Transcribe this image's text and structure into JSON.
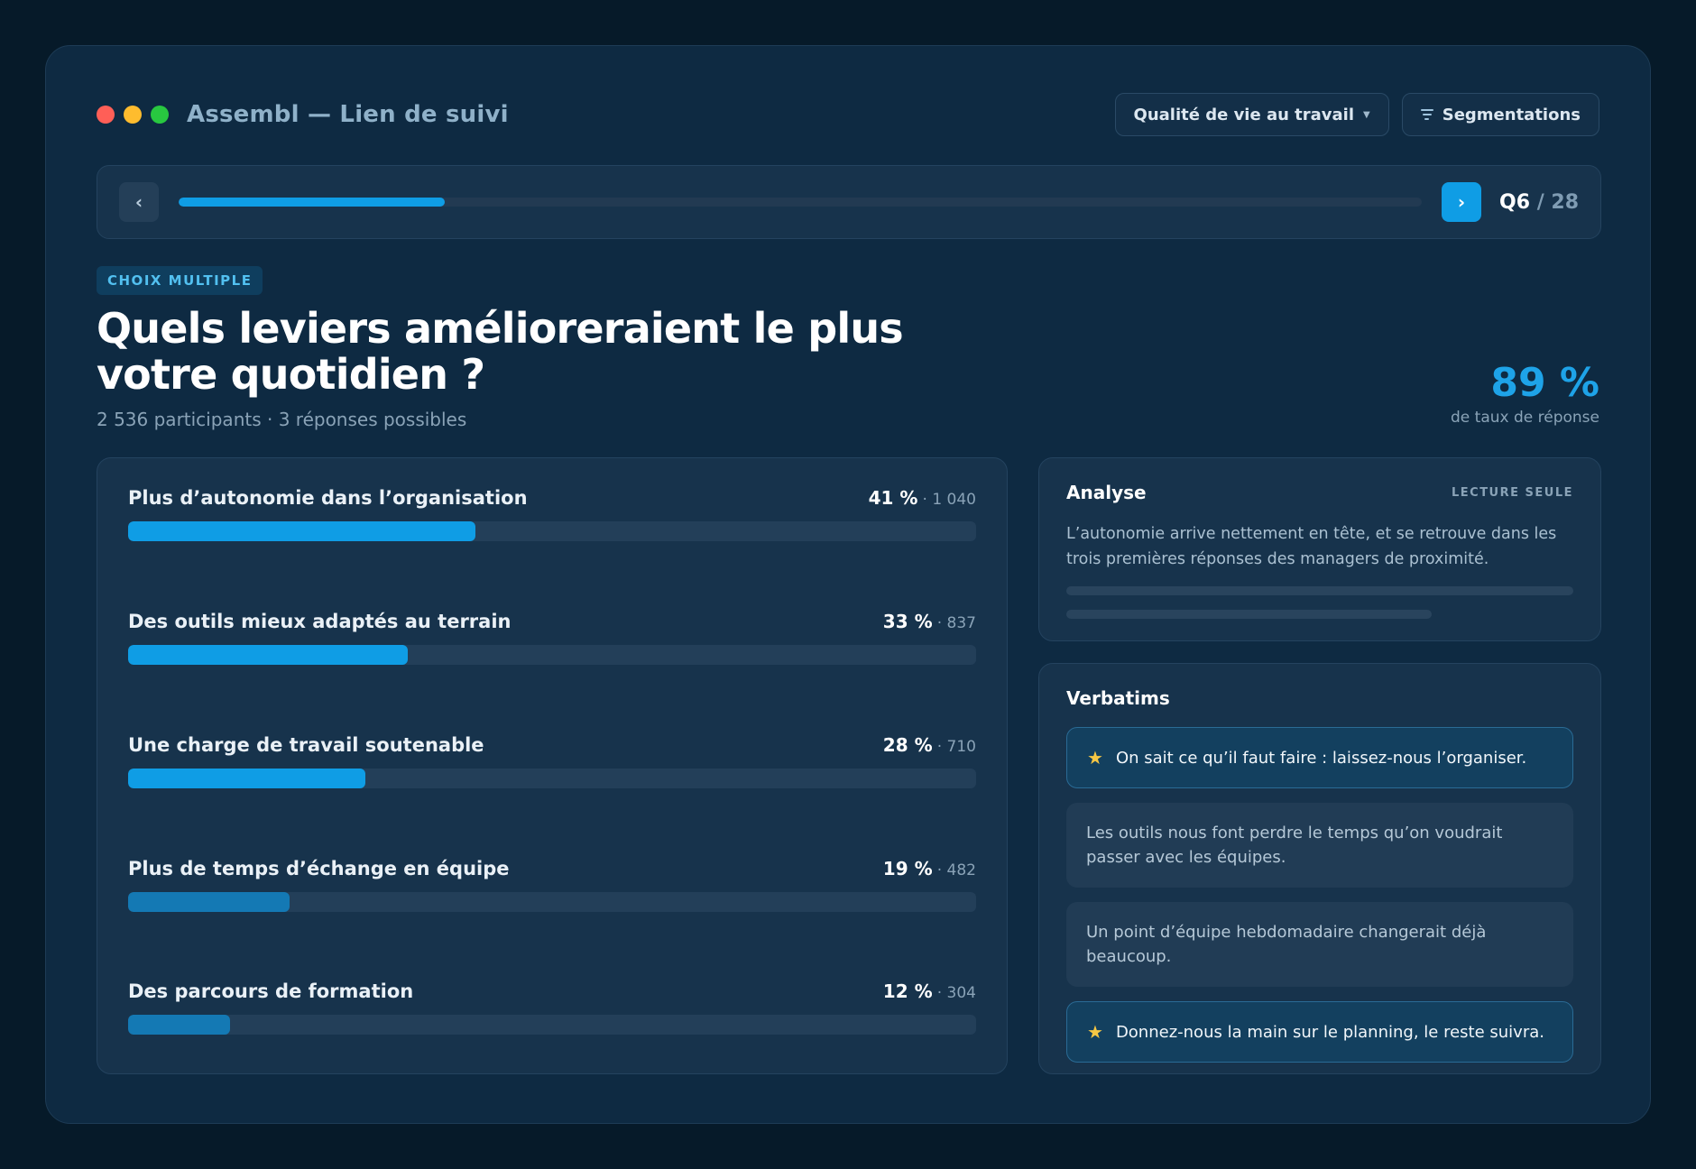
{
  "window": {
    "title": "Assembl — Lien de suivi",
    "dot_colors": [
      "#ff5f57",
      "#febc2e",
      "#28c840"
    ]
  },
  "header": {
    "survey_selector": {
      "label": "Qualité de vie au travail",
      "icon": "chevron-down-icon"
    },
    "segmentations": {
      "label": "Segmentations",
      "icon": "filter-icon"
    }
  },
  "navigation": {
    "prev_icon": "chevron-left-icon",
    "next_icon": "chevron-right-icon",
    "progress_fraction": 0.214,
    "current": "Q6",
    "total": "/ 28"
  },
  "question": {
    "type": "CHOIX MULTIPLE",
    "title": "Quels leviers amélioreraient le plus votre quotidien ?",
    "subtitle": "2 536 participants · 3 réponses possibles",
    "response_rate": {
      "value": "89 %",
      "label": "de taux de réponse"
    }
  },
  "results": {
    "options": [
      {
        "label": "Plus d’autonomie dans l’organisation",
        "pct": "41 %",
        "count": "· 1 040",
        "fraction": 0.41,
        "color": "#0f9de5"
      },
      {
        "label": "Des outils mieux adaptés au terrain",
        "pct": "33 %",
        "count": "· 837",
        "fraction": 0.33,
        "color": "#0f9de5"
      },
      {
        "label": "Une charge de travail soutenable",
        "pct": "28 %",
        "count": "· 710",
        "fraction": 0.28,
        "color": "#0f9de5"
      },
      {
        "label": "Plus de temps d’échange en équipe",
        "pct": "19 %",
        "count": "· 482",
        "fraction": 0.19,
        "color": "#1479b4"
      },
      {
        "label": "Des parcours de formation",
        "pct": "12 %",
        "count": "· 304",
        "fraction": 0.12,
        "color": "#1479b4"
      }
    ]
  },
  "analysis": {
    "title": "Analyse",
    "badge": "LECTURE SEULE",
    "text": "L’autonomie arrive nettement en tête, et se retrouve dans les trois premières réponses des managers de proximité."
  },
  "verbatims": {
    "title": "Verbatims",
    "items": [
      {
        "text": "On sait ce qu’il faut faire : laissez-nous l’organiser.",
        "highlighted": true
      },
      {
        "text": "Les outils nous font perdre le temps qu’on voudrait passer avec les équipes.",
        "highlighted": false
      },
      {
        "text": "Un point d’équipe hebdomadaire changerait déjà beaucoup.",
        "highlighted": false
      },
      {
        "text": "Donnez-nous la main sur le planning, le reste suivra.",
        "highlighted": true
      }
    ]
  },
  "colors": {
    "accent": "#0f9de5",
    "background": "#061a29",
    "panel": "#17334c",
    "star": "#f6c744"
  }
}
